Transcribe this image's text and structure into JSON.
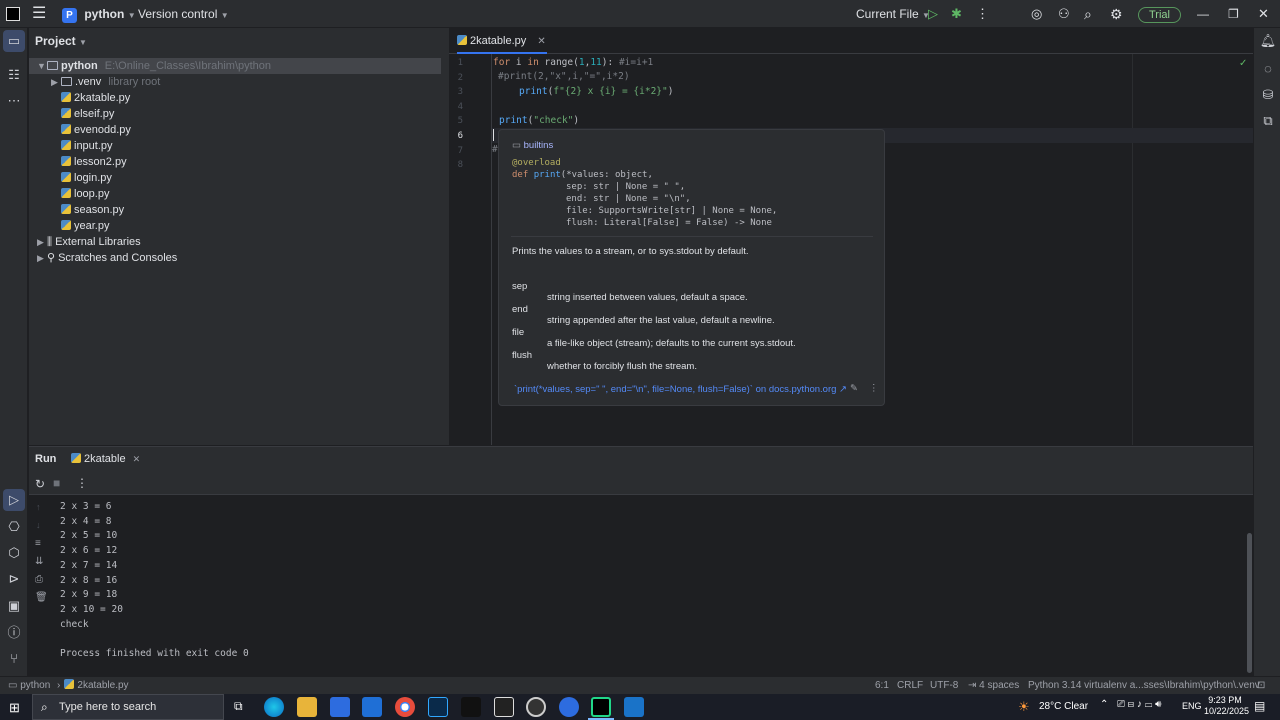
{
  "titlebar": {
    "project_badge": "P",
    "project_name": "python",
    "vcs": "Version control",
    "run_config": "Current File",
    "trial": "Trial"
  },
  "project": {
    "header": "Project",
    "root_name": "python",
    "root_path": "E:\\Online_Classes\\Ibrahim\\python",
    "venv": ".venv",
    "venv_hint": "library root",
    "files": [
      "2katable.py",
      "elseif.py",
      "evenodd.py",
      "input.py",
      "lesson2.py",
      "login.py",
      "loop.py",
      "season.py",
      "year.py"
    ],
    "external": "External Libraries",
    "scratches": "Scratches and Consoles"
  },
  "editor": {
    "tab": "2katable.py",
    "line_numbers": [
      "1",
      "2",
      "3",
      "4",
      "5",
      "6",
      "7",
      "8"
    ],
    "lines": {
      "l1_kw": "for",
      "l1_a": " i ",
      "l1_kw2": "in",
      "l1_fn": " range",
      "l1_b": "(",
      "l1_num": "1",
      "l1_c": ",",
      "l1_num2": "11",
      "l1_d": "): ",
      "l1_cm": "#i=i+1",
      "l2_cm": "#print(2,\"x\",i,\"=\",i*2)",
      "l3_fn": "print",
      "l3_a": "(",
      "l3_str": "f\"{2} x {i} = {i*2}\"",
      "l3_b": ")",
      "l5_fn": "print",
      "l5_a": "(",
      "l5_str": "\"check\"",
      "l5_b": ")",
      "l7_cm": "#"
    }
  },
  "doc_popup": {
    "module": "builtins",
    "decorator": "@overload",
    "sig_def": "def",
    "sig_name": "print",
    "sig_l1": "(*values: object,",
    "sig_l2": "sep: str | None = \" \",",
    "sig_l3": "end: str | None = \"\\n\",",
    "sig_l4": "file: SupportsWrite[str] | None = None,",
    "sig_l5": "flush: Literal[False] = False) -> None",
    "description": "Prints the values to a stream, or to sys.stdout by default.",
    "params": [
      {
        "name": "sep",
        "desc": "string inserted between values, default a space."
      },
      {
        "name": "end",
        "desc": "string appended after the last value, default a newline."
      },
      {
        "name": "file",
        "desc": "a file-like object (stream); defaults to the current sys.stdout."
      },
      {
        "name": "flush",
        "desc": "whether to forcibly flush the stream."
      }
    ],
    "footer_link": "`print(*values, sep=\" \", end=\"\\n\", file=None, flush=False)` on docs.python.org ↗"
  },
  "run": {
    "title": "Run",
    "tab": "2katable",
    "output": [
      "2 x 3 = 6",
      "2 x 4 = 8",
      "2 x 5 = 10",
      "2 x 6 = 12",
      "2 x 7 = 14",
      "2 x 8 = 16",
      "2 x 9 = 18",
      "2 x 10 = 20",
      "check",
      "",
      "Process finished with exit code 0"
    ]
  },
  "statusbar": {
    "breadcrumb_project": "python",
    "breadcrumb_file": "2katable.py",
    "position": "6:1",
    "line_sep": "CRLF",
    "encoding": "UTF-8",
    "indent": "4 spaces",
    "interpreter": "Python 3.14 virtualenv a...sses\\Ibrahim\\python\\.venv"
  },
  "taskbar": {
    "search_placeholder": "Type here to search",
    "weather": "28°C  Clear",
    "lang": "ENG",
    "time": "9:23 PM",
    "date": "10/22/2025"
  },
  "colors": {
    "accent": "#3574f0",
    "trial_green": "#57965c"
  }
}
